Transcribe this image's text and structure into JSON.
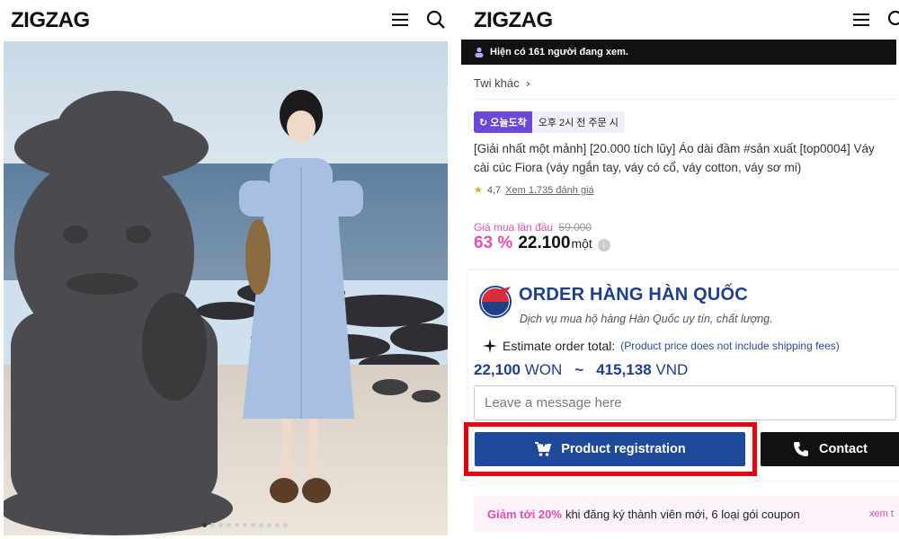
{
  "left": {
    "logo": "ZIGZAG",
    "menu_icon": "hamburger-menu-icon",
    "search_icon": "search-icon",
    "carousel": {
      "total": 11,
      "active": 1
    }
  },
  "right": {
    "logo": "ZIGZAG",
    "viewers": "Hiện có 161 người đang xem.",
    "store_link": "Twi khác",
    "badge_delivery": "오늘도착",
    "badge_time": "오후 2시 전 주문 시",
    "product_title": "[Giải nhất một mảnh] [20.000 tích lũy] Áo dài đầm #sản xuất [top0004] Váy cài cúc Fiora (váy ngắn tay, váy có cổ, váy cotton, váy sơ mi)",
    "rating": "4,7",
    "reviews_link": "Xem 1.735 đánh giá",
    "first_price_label": "Giá mua lần đầu",
    "original_price": "59.000",
    "discount": "63 %",
    "price": "22.100",
    "price_unit": "một",
    "order": {
      "title": "ORDER HÀNG HÀN QUỐC",
      "subtitle": "Dịch vụ mua hộ hàng Hàn Quốc uy tín, chất lượng.",
      "estimate_label": "Estimate order total:",
      "estimate_note": "(Product price does not include shipping fees)",
      "won_value": "22,100",
      "won_unit": "WON",
      "separator": "~",
      "vnd_value": "415,138",
      "vnd_unit": "VND",
      "message_placeholder": "Leave a message here",
      "register_button": "Product registration",
      "contact_button": "Contact"
    },
    "coupon": {
      "highlight": "Giảm tới 20%",
      "text": "khi đăng ký thành viên mới, 6 loại gói coupon",
      "more": "xem t"
    }
  },
  "colors": {
    "brand_blue": "#1f4a9c",
    "pink": "#e64eb4",
    "highlight_red": "#e4000f",
    "purple_badge": "#6b49d6"
  }
}
